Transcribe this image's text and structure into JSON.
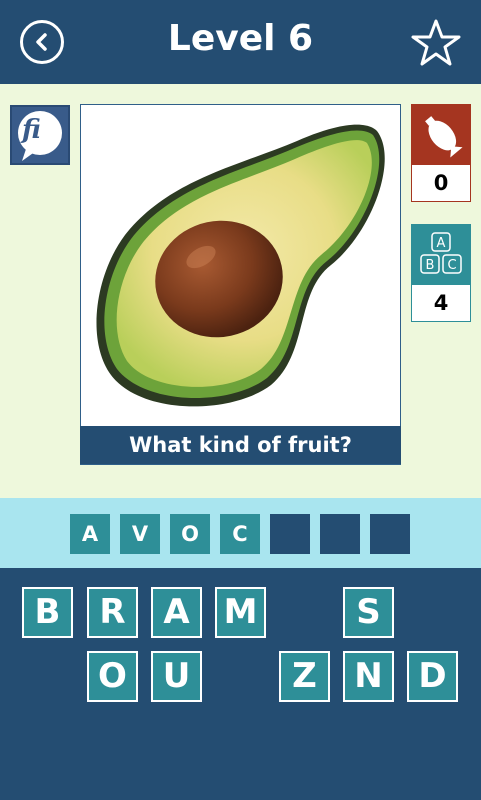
{
  "header": {
    "title": "Level 6",
    "back_icon": "back-arrow-icon",
    "favorite_icon": "star-icon"
  },
  "social": {
    "label": "fi",
    "icon": "facebook-share-icon"
  },
  "picture": {
    "subject": "avocado",
    "question": "What kind of fruit?"
  },
  "hints": {
    "bomb": {
      "icon": "bomb-icon",
      "count": "0",
      "color": "#a53520"
    },
    "reveal": {
      "icon": "abc-blocks-icon",
      "count": "4",
      "color": "#2e8f98"
    }
  },
  "answer": {
    "slots": [
      "A",
      "V",
      "O",
      "C",
      "",
      "",
      ""
    ]
  },
  "letters": {
    "row1": [
      "B",
      "R",
      "A",
      "M",
      "S"
    ],
    "row2": [
      "O",
      "U",
      "Z",
      "N",
      "D"
    ]
  },
  "colors": {
    "header": "#244d72",
    "content_bg": "#eef8dc",
    "tile": "#2e8f98",
    "answer_bar": "#a9e5ef"
  }
}
